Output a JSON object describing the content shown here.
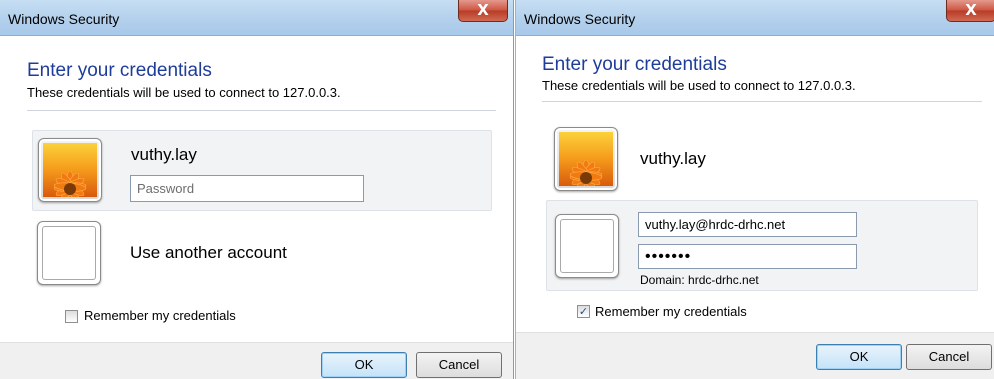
{
  "dialogs": [
    {
      "title": "Windows Security",
      "close_label": "X",
      "heading": "Enter your credentials",
      "subtext": "These credentials will be used to connect to 127.0.0.3.",
      "selected_account": {
        "username": "vuthy.lay",
        "password_placeholder": "Password"
      },
      "other_account": {
        "label": "Use another account"
      },
      "remember": {
        "label": "Remember my credentials",
        "checked": false
      },
      "ok_label": "OK",
      "cancel_label": "Cancel"
    },
    {
      "title": "Windows Security",
      "close_label": "X",
      "heading": "Enter your credentials",
      "subtext": "These credentials will be used to connect to 127.0.0.3.",
      "account": {
        "username": "vuthy.lay"
      },
      "other_account": {
        "username_value": "vuthy.lay@hrdc-drhc.net",
        "password_value": "•••••••",
        "domain_text": "Domain: hrdc-drhc.net"
      },
      "remember": {
        "label": "Remember my credentials",
        "checked": true,
        "check_glyph": "✓"
      },
      "ok_label": "OK",
      "cancel_label": "Cancel"
    }
  ]
}
